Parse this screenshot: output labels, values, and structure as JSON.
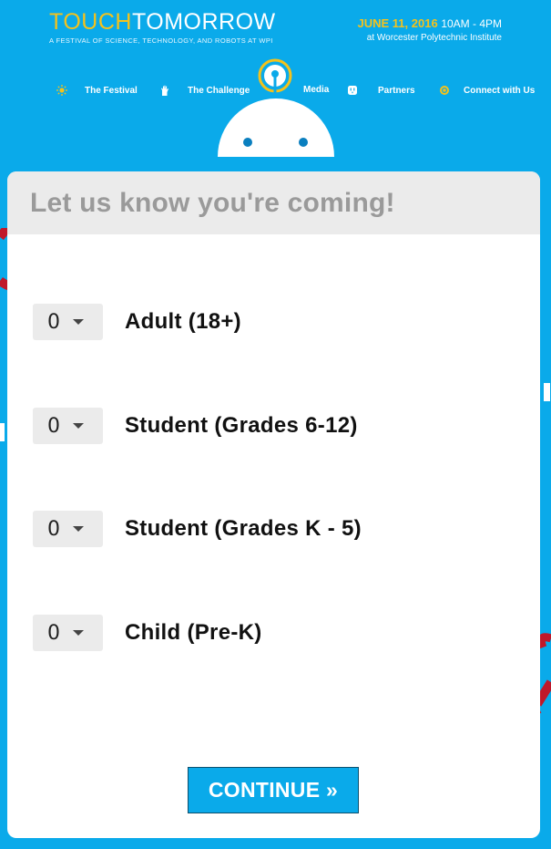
{
  "header": {
    "logo_touch": "TOUCH",
    "logo_tomorrow": "TOMORROW",
    "tagline": "A FESTIVAL OF SCIENCE, TECHNOLOGY, AND ROBOTS AT WPI",
    "date": "JUNE 11, 2016",
    "time": "10AM - 4PM",
    "location": "at Worcester Polytechnic Institute"
  },
  "nav": {
    "items": [
      {
        "label": "The Festival",
        "icon": "sun-icon"
      },
      {
        "label": "The Challenge",
        "icon": "hand-icon"
      },
      {
        "label": "Media",
        "icon": "robot-antenna-icon"
      },
      {
        "label": "Partners",
        "icon": "outlet-icon"
      },
      {
        "label": "Connect with Us",
        "icon": "circle-icon"
      }
    ]
  },
  "card": {
    "title": "Let us know you're coming!",
    "tickets": [
      {
        "label": "Adult (18+)",
        "value": "0"
      },
      {
        "label": "Student (Grades 6-12)",
        "value": "0"
      },
      {
        "label": "Student (Grades K - 5)",
        "value": "0"
      },
      {
        "label": "Child (Pre-K)",
        "value": "0"
      }
    ],
    "continue_label": "CONTINUE »"
  },
  "colors": {
    "background": "#0aaaea",
    "accent_yellow": "#f5c21b",
    "magnet_red": "#c0182a"
  }
}
